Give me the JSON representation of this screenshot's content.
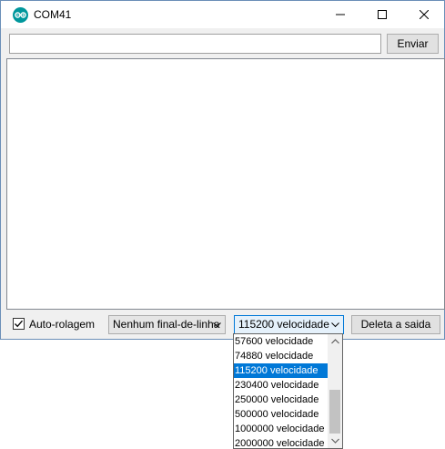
{
  "window": {
    "title": "COM41",
    "controls": [
      "minimize-icon",
      "maximize-icon",
      "close-icon"
    ]
  },
  "send": {
    "input_value": "",
    "input_placeholder": "",
    "button_label": "Enviar"
  },
  "bottom": {
    "autoscroll_label": "Auto-rolagem",
    "autoscroll_checked": true,
    "line_ending_value": "Nenhum final-de-linha",
    "baud_value": "115200 velocidade",
    "clear_label": "Deleta a saida"
  },
  "baud_dropdown": {
    "options": [
      "57600 velocidade",
      "74880 velocidade",
      "115200 velocidade",
      "230400 velocidade",
      "250000 velocidade",
      "500000 velocidade",
      "1000000 velocidade",
      "2000000 velocidade"
    ],
    "selected": "115200 velocidade"
  },
  "colors": {
    "accent": "#0078d7",
    "window_bg": "#f0f0f0",
    "icon_teal": "#00979c"
  }
}
